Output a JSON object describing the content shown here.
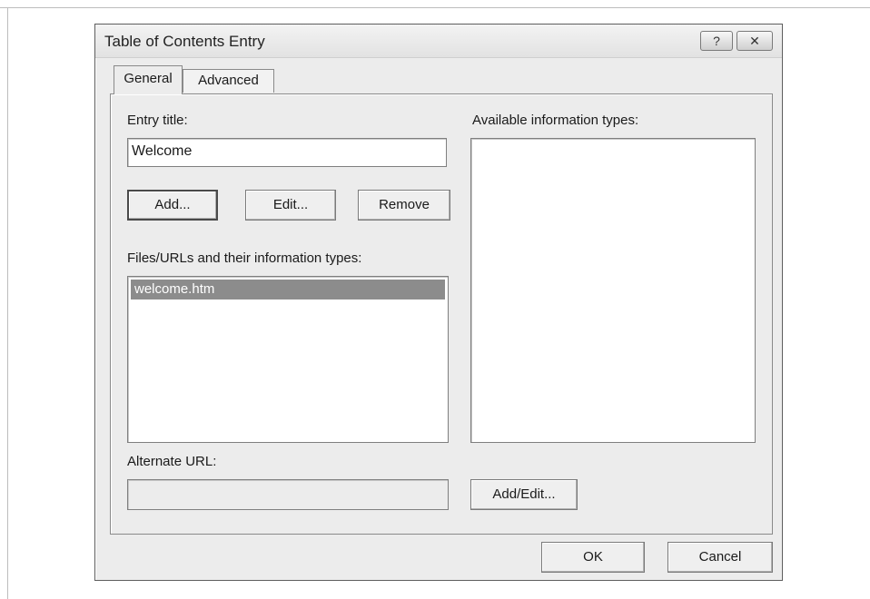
{
  "window": {
    "title": "Table of Contents Entry",
    "help_glyph": "?",
    "close_glyph": "✕"
  },
  "tabs": [
    {
      "label": "General",
      "selected": true
    },
    {
      "label": "Advanced",
      "selected": false
    }
  ],
  "general": {
    "entry_title_label": "Entry title:",
    "entry_title_value": "Welcome",
    "add_button": "Add...",
    "edit_button": "Edit...",
    "remove_button": "Remove",
    "files_label": "Files/URLs and their information types:",
    "files": [
      {
        "name": "welcome.htm",
        "selected": true
      }
    ],
    "alternate_url_label": "Alternate URL:",
    "alternate_url_value": "",
    "info_types_label": "Available information types:",
    "info_types": [],
    "add_edit_button": "Add/Edit..."
  },
  "footer": {
    "ok_button": "OK",
    "cancel_button": "Cancel"
  },
  "icons": {
    "help": "help-icon",
    "close": "close-icon"
  }
}
